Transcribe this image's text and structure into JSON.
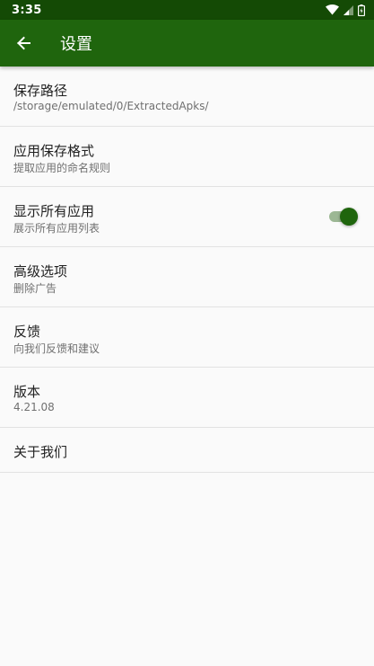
{
  "status_bar": {
    "time": "3:35"
  },
  "app_bar": {
    "title": "设置"
  },
  "settings": {
    "save_path": {
      "title": "保存路径",
      "subtitle": "/storage/emulated/0/ExtractedApks/"
    },
    "save_format": {
      "title": "应用保存格式",
      "subtitle": "提取应用的命名规则"
    },
    "show_all_apps": {
      "title": "显示所有应用",
      "subtitle": "展示所有应用列表",
      "enabled": true
    },
    "advanced": {
      "title": "高级选项",
      "subtitle": "删除广告"
    },
    "feedback": {
      "title": "反馈",
      "subtitle": "向我们反馈和建议"
    },
    "version": {
      "title": "版本",
      "subtitle": "4.21.08"
    },
    "about": {
      "title": "关于我们"
    }
  },
  "colors": {
    "status_bar": "#144A05",
    "app_bar": "#1F650D",
    "accent": "#1F650D"
  }
}
